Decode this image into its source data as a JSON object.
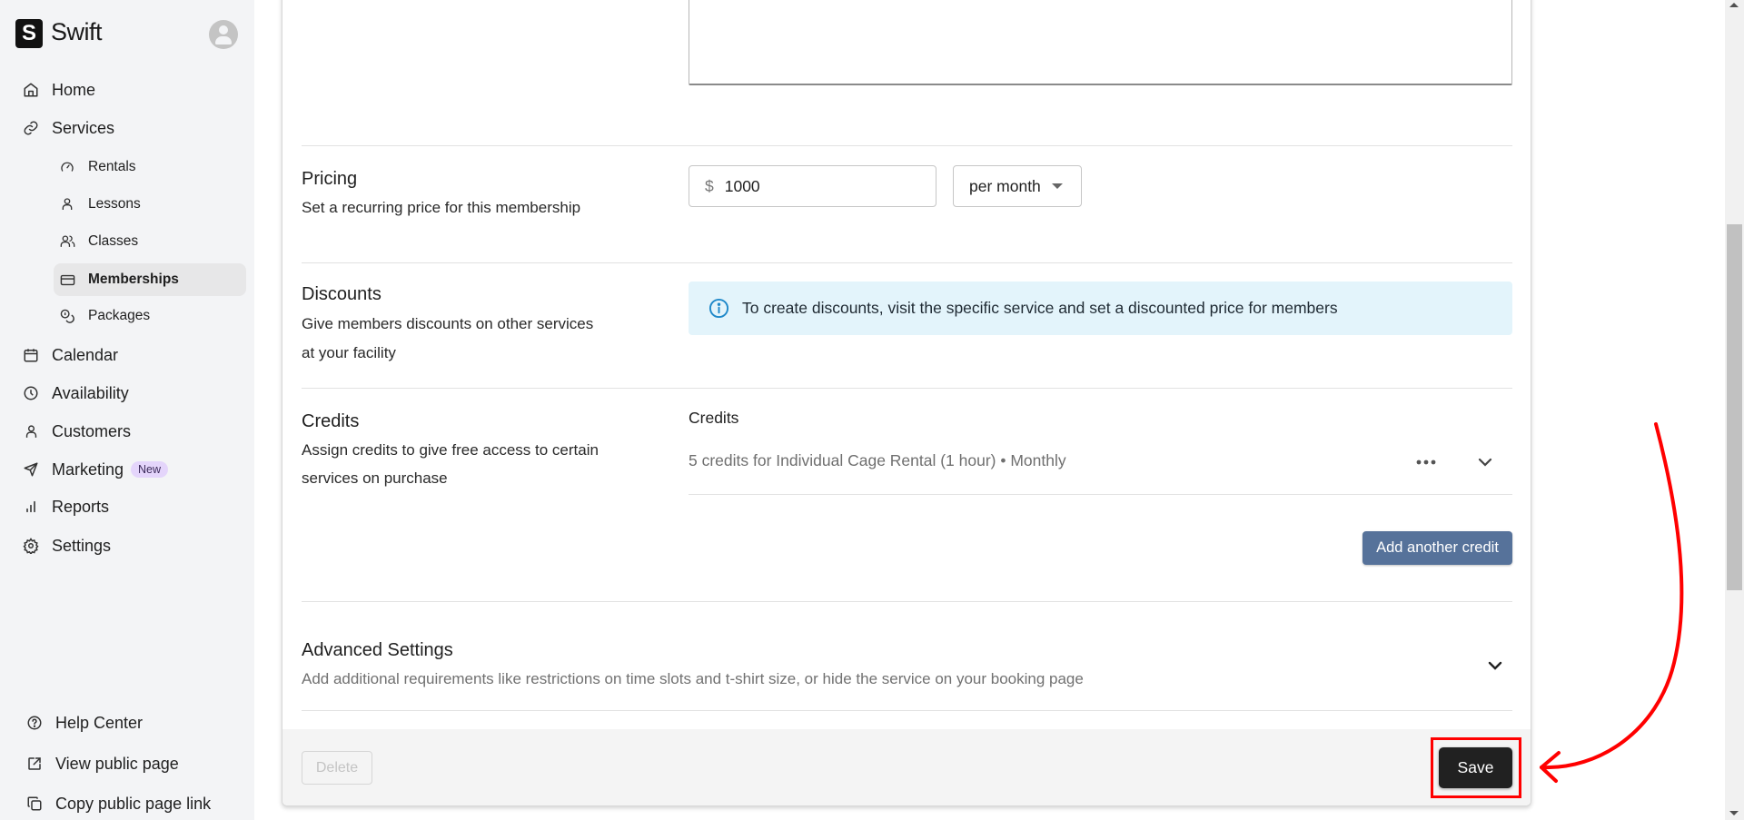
{
  "app": {
    "name": "Swift",
    "logo_letter": "S"
  },
  "sidebar": {
    "nav": [
      {
        "label": "Home",
        "icon": "home-icon"
      },
      {
        "label": "Services",
        "icon": "link-icon"
      }
    ],
    "services_sub": [
      {
        "label": "Rentals",
        "icon": "gauge-icon"
      },
      {
        "label": "Lessons",
        "icon": "user-icon"
      },
      {
        "label": "Classes",
        "icon": "users-icon"
      },
      {
        "label": "Memberships",
        "icon": "card-icon",
        "active": true
      },
      {
        "label": "Packages",
        "icon": "coins-icon"
      }
    ],
    "nav2": [
      {
        "label": "Calendar",
        "icon": "calendar-icon"
      },
      {
        "label": "Availability",
        "icon": "clock-icon"
      },
      {
        "label": "Customers",
        "icon": "user-icon"
      },
      {
        "label": "Marketing",
        "icon": "send-icon",
        "badge": "New"
      },
      {
        "label": "Reports",
        "icon": "bar-chart-icon"
      },
      {
        "label": "Settings",
        "icon": "gear-icon"
      }
    ],
    "footer": [
      {
        "label": "Help Center",
        "icon": "help-circle-icon"
      },
      {
        "label": "View public page",
        "icon": "external-link-icon"
      },
      {
        "label": "Copy public page link",
        "icon": "copy-icon"
      }
    ]
  },
  "form": {
    "pricing": {
      "title": "Pricing",
      "description": "Set a recurring price for this membership",
      "currency_symbol": "$",
      "amount": "1000",
      "period": "per month"
    },
    "discounts": {
      "title": "Discounts",
      "description_line1": "Give members discounts on other services",
      "description_line2": "at your facility",
      "info": "To create discounts, visit the specific service and set a discounted price for members"
    },
    "credits": {
      "title": "Credits",
      "description_line1": "Assign credits to give free access to certain",
      "description_line2": "services on purchase",
      "list_label": "Credits",
      "items": [
        {
          "text": "5 credits for Individual Cage Rental (1 hour) • Monthly"
        }
      ],
      "add_button": "Add another credit"
    },
    "advanced": {
      "title": "Advanced Settings",
      "description": "Add additional requirements like restrictions on time slots and t-shirt size, or hide the service on your booking page"
    }
  },
  "footer": {
    "delete_label": "Delete",
    "save_label": "Save"
  },
  "colors": {
    "annotation": "#ff0000",
    "primary_button": "#212121",
    "secondary_button": "#56729a",
    "info_bg": "#e3f4fb",
    "badge_bg": "#e4d5fb"
  }
}
